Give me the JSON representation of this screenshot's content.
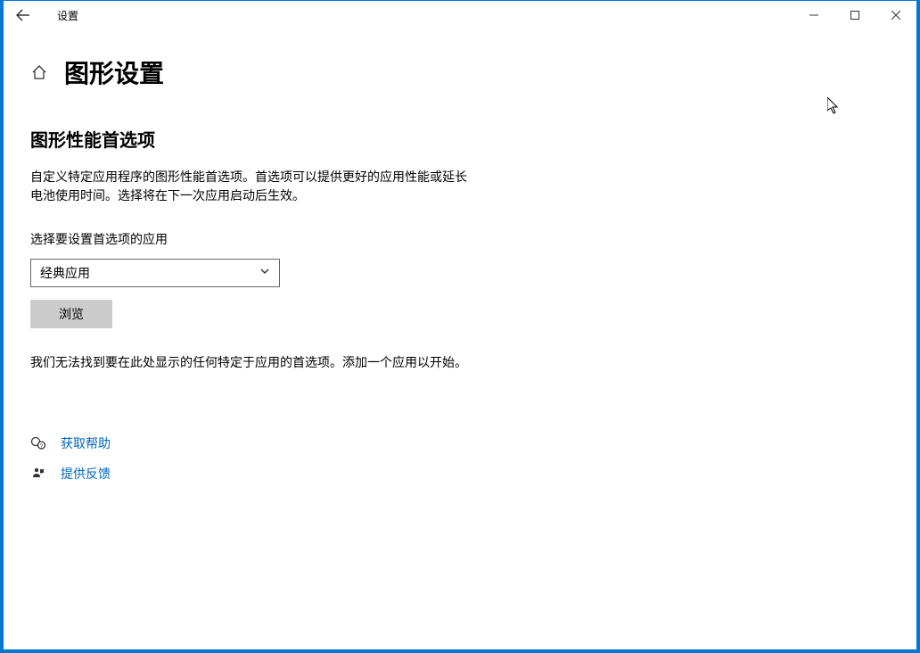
{
  "window": {
    "title": "设置"
  },
  "page": {
    "title": "图形设置"
  },
  "section": {
    "title": "图形性能首选项",
    "description": "自定义特定应用程序的图形性能首选项。首选项可以提供更好的应用性能或延长电池使用时间。选择将在下一次应用启动后生效。"
  },
  "app_selector": {
    "label": "选择要设置首选项的应用",
    "selected": "经典应用"
  },
  "browse": {
    "label": "浏览"
  },
  "empty": {
    "text": "我们无法找到要在此处显示的任何特定于应用的首选项。添加一个应用以开始。"
  },
  "links": {
    "help": "获取帮助",
    "feedback": "提供反馈"
  }
}
